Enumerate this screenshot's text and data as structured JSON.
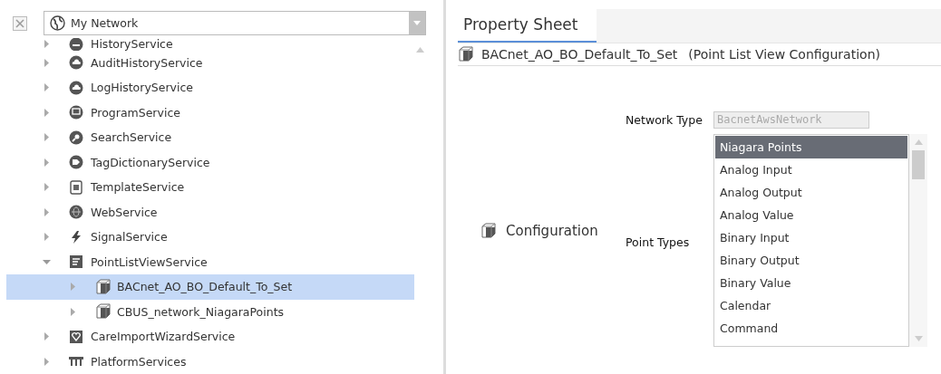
{
  "network_selector": {
    "value": "My Network"
  },
  "tree": [
    {
      "label": "HistoryService",
      "expanded": false,
      "selected": false
    },
    {
      "label": "AuditHistoryService",
      "expanded": false,
      "selected": false
    },
    {
      "label": "LogHistoryService",
      "expanded": false,
      "selected": false
    },
    {
      "label": "ProgramService",
      "expanded": false,
      "selected": false
    },
    {
      "label": "SearchService",
      "expanded": false,
      "selected": false
    },
    {
      "label": "TagDictionaryService",
      "expanded": false,
      "selected": false
    },
    {
      "label": "TemplateService",
      "expanded": false,
      "selected": false
    },
    {
      "label": "WebService",
      "expanded": false,
      "selected": false
    },
    {
      "label": "SignalService",
      "expanded": false,
      "selected": false
    },
    {
      "label": "PointListViewService",
      "expanded": true,
      "selected": false,
      "children": [
        {
          "label": "BACnet_AO_BO_Default_To_Set",
          "expanded": false,
          "selected": true
        },
        {
          "label": "CBUS_network_NiagaraPoints",
          "expanded": false,
          "selected": false
        }
      ]
    },
    {
      "label": "CareImportWizardService",
      "expanded": false,
      "selected": false
    },
    {
      "label": "PlatformServices",
      "expanded": false,
      "selected": false
    }
  ],
  "tabs": [
    {
      "label": "Property Sheet",
      "selected": true
    }
  ],
  "header": {
    "name": "BACnet_AO_BO_Default_To_Set",
    "type": "(Point List View Configuration)"
  },
  "section": {
    "label": "Configuration"
  },
  "network_type": {
    "label": "Network Type",
    "value": "BacnetAwsNetwork",
    "disabled": true
  },
  "point_types": {
    "label": "Point Types",
    "options": [
      {
        "label": "Niagara Points",
        "selected": true
      },
      {
        "label": "Analog Input",
        "selected": false
      },
      {
        "label": "Analog Output",
        "selected": false
      },
      {
        "label": "Analog Value",
        "selected": false
      },
      {
        "label": "Binary Input",
        "selected": false
      },
      {
        "label": "Binary Output",
        "selected": false
      },
      {
        "label": "Binary Value",
        "selected": false
      },
      {
        "label": "Calendar",
        "selected": false
      },
      {
        "label": "Command",
        "selected": false
      }
    ]
  }
}
